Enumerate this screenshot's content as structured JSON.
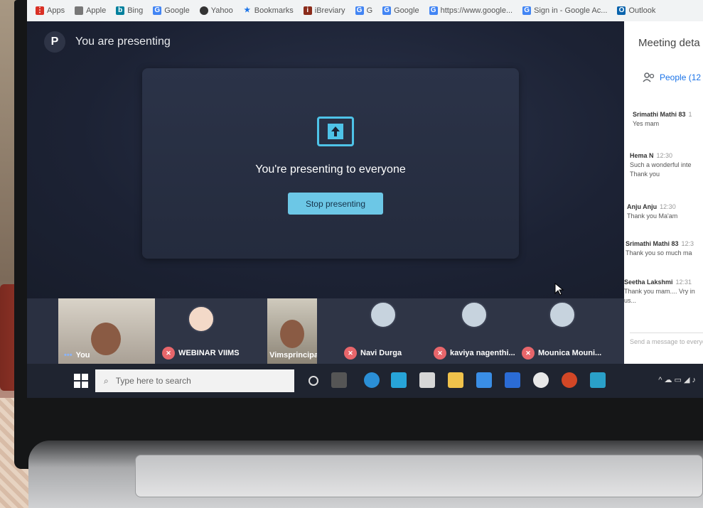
{
  "bookmarks": [
    "Apps",
    "Apple",
    "Bing",
    "Google",
    "Yahoo",
    "Bookmarks",
    "iBreviary",
    "G",
    "Google",
    "https://www.google...",
    "Sign in - Google Ac...",
    "Outlook"
  ],
  "presenting": {
    "avatar_letter": "P",
    "header": "You are presenting",
    "message": "You're presenting to everyone",
    "stop_button": "Stop presenting"
  },
  "side_panel": {
    "title": "Meeting deta",
    "people_label": "People (12",
    "messages": [
      {
        "who": "Srimathi Mathi 83",
        "time": "1",
        "text": "Yes mam"
      },
      {
        "who": "Hema N",
        "time": "12:30",
        "text": "Such a wonderful inte",
        "text2": "Thank you"
      },
      {
        "who": "Anju Anju",
        "time": "12:30",
        "text": "Thank you Ma'am"
      },
      {
        "who": "Srimathi Mathi 83",
        "time": "12:3",
        "text": "Thank you so much ma"
      },
      {
        "who": "Seetha Lakshmi",
        "time": "12:31",
        "text": "Thank you mam.... Vry in",
        "text2": "us..."
      }
    ],
    "send_placeholder": "Send a message to everyo"
  },
  "participants": [
    {
      "name": "You"
    },
    {
      "name": "WEBINAR VIIMS"
    },
    {
      "name": "Vimsprincipal"
    },
    {
      "name": "Navi Durga"
    },
    {
      "name": "kaviya nagenthi..."
    },
    {
      "name": "Mounica Mouni..."
    }
  ],
  "taskbar": {
    "search_placeholder": "Type here to search"
  },
  "colors": {
    "accent": "#6cc7e6",
    "mic_off": "#e8666b",
    "meet_bg": "#1e2433"
  }
}
